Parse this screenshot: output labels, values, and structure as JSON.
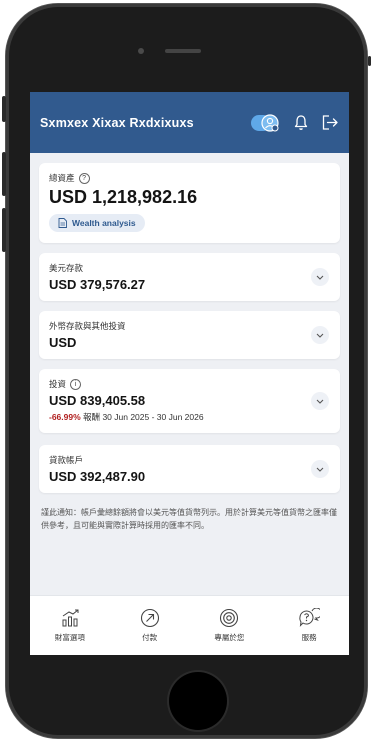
{
  "app": {
    "title": "Sxmxex Xixax Rxdxixuxs"
  },
  "summary": {
    "label": "總資產",
    "help": "?",
    "amount": "USD 1,218,982.16",
    "wealth_button": "Wealth analysis"
  },
  "accounts": [
    {
      "label": "美元存款",
      "amount": "USD 379,576.27"
    },
    {
      "label": "外幣存款與其他投資",
      "amount": "USD"
    },
    {
      "label": "投資",
      "info": "i",
      "amount": "USD 839,405.58",
      "return_pct": "-66.99%",
      "return_label": "報酬",
      "period": "30 Jun 2025 - 30 Jun 2026"
    },
    {
      "label": "貸款帳戶",
      "amount": "USD 392,487.90"
    }
  ],
  "notice": "謹此通知：帳戶彙總餘額將會以美元等值貨幣列示。用於計算美元等值貨幣之匯率僅供參考，且可能與實際計算時採用的匯率不同。",
  "nav": [
    {
      "label": "財富選項",
      "icon": "chart-growth-icon"
    },
    {
      "label": "付款",
      "icon": "send-payment-icon"
    },
    {
      "label": "專屬於您",
      "icon": "target-icon"
    },
    {
      "label": "服務",
      "icon": "help-chat-icon"
    }
  ],
  "colors": {
    "header": "#315a8e",
    "negative": "#b11f1f",
    "accent": "#2f5a8f"
  }
}
